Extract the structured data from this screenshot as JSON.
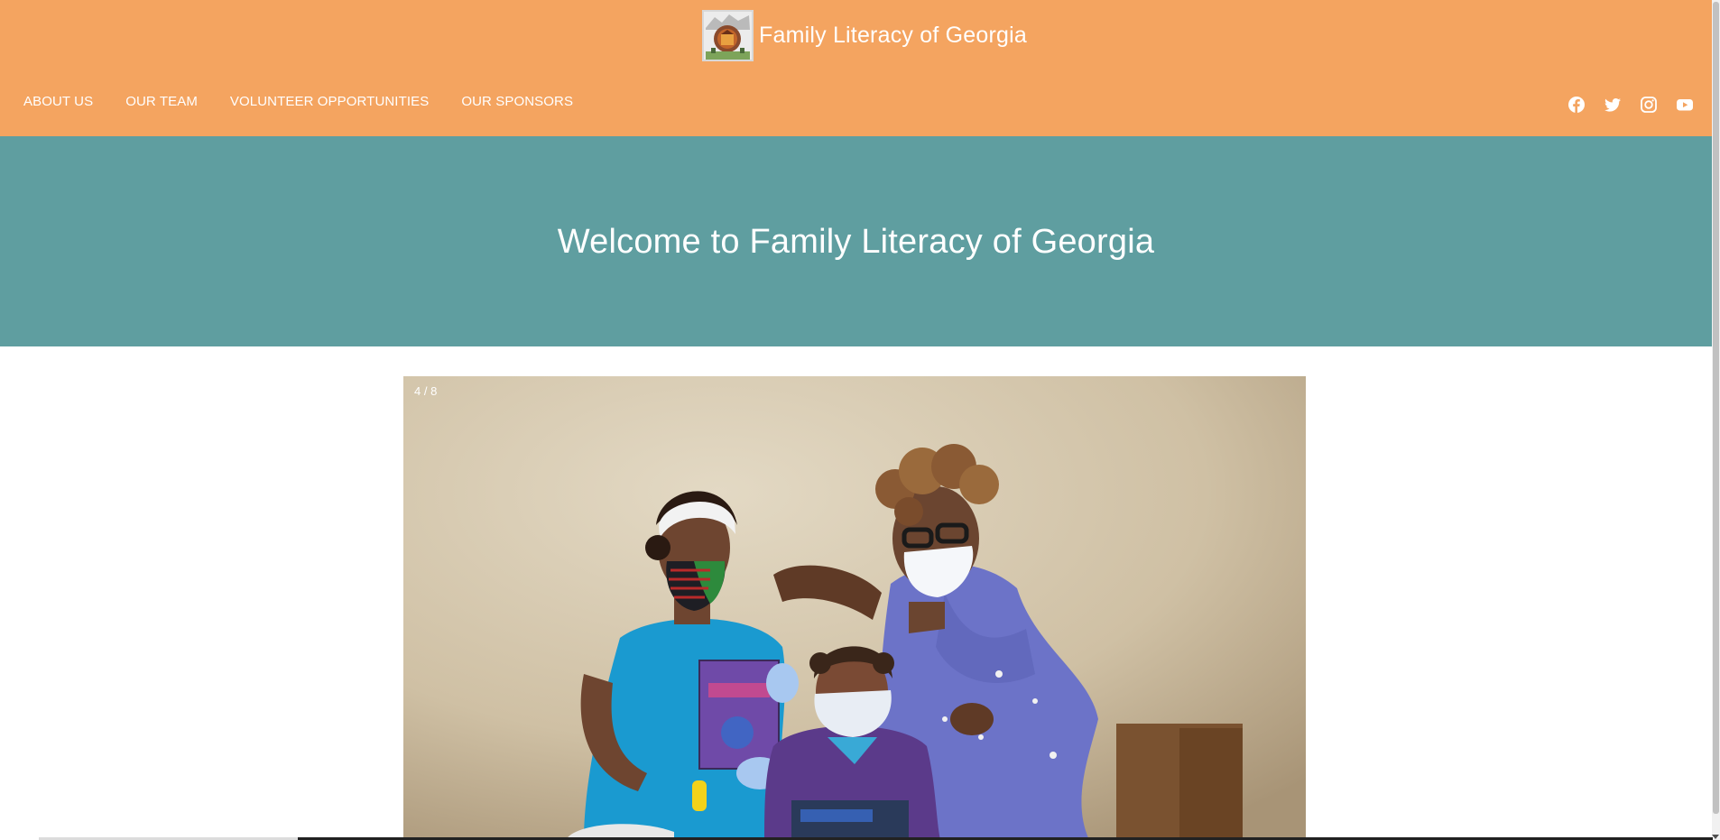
{
  "theme": {
    "header_bg": "#f4a460",
    "banner_bg": "#5f9ea0"
  },
  "header": {
    "site_title": "Family Literacy of Georgia",
    "logo_icon": "family-literacy-logo"
  },
  "nav": {
    "items": [
      {
        "label": "ABOUT US"
      },
      {
        "label": "OUR TEAM"
      },
      {
        "label": "VOLUNTEER OPPORTUNITIES"
      },
      {
        "label": "OUR SPONSORS"
      }
    ]
  },
  "social": {
    "icons": [
      "facebook-icon",
      "twitter-icon",
      "instagram-icon",
      "youtube-icon"
    ]
  },
  "banner": {
    "heading": "Welcome to Family Literacy of Georgia"
  },
  "slideshow": {
    "counter": "4 / 8"
  }
}
